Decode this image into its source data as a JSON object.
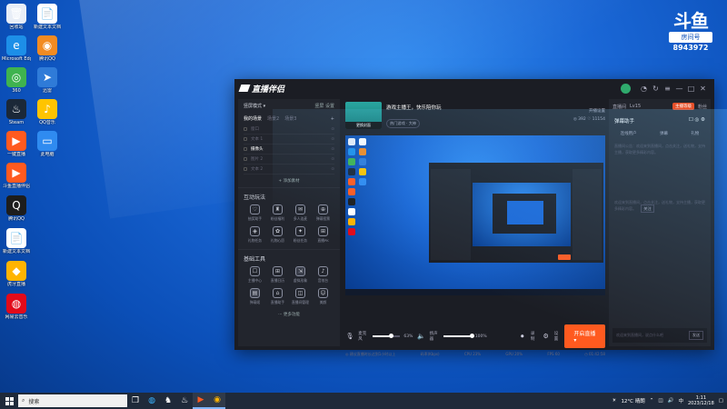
{
  "desktop": {
    "icons": [
      {
        "label": "回收站",
        "color": "#e8eef7",
        "glyph": "🗑"
      },
      {
        "label": "新建文本文档",
        "color": "#ffffff",
        "glyph": "📄"
      },
      {
        "label": "Microsoft Edge",
        "color": "#1d8fe8",
        "glyph": "e"
      },
      {
        "label": "腾讯QQ",
        "color": "#f28b22",
        "glyph": "◉"
      },
      {
        "label": "360",
        "color": "#3fb34f",
        "glyph": "◎"
      },
      {
        "label": "迅雷",
        "color": "#2f7bd8",
        "glyph": "➤"
      },
      {
        "label": "Steam",
        "color": "#1b2838",
        "glyph": "♨"
      },
      {
        "label": "QQ音乐",
        "color": "#ffc400",
        "glyph": "♪"
      },
      {
        "label": "一键直播",
        "color": "#ff5a1f",
        "glyph": "▶"
      },
      {
        "label": "此电脑",
        "color": "#2f8bf0",
        "glyph": "▭"
      },
      {
        "label": "斗鱼直播伴侣",
        "color": "#ff5a1f",
        "glyph": "▶"
      },
      {
        "label": "",
        "color": "",
        "glyph": ""
      },
      {
        "label": "腾讯QQ",
        "color": "#1d1d1d",
        "glyph": "Q"
      },
      {
        "label": "",
        "color": "",
        "glyph": ""
      },
      {
        "label": "新建文本文档",
        "color": "#ffffff",
        "glyph": "📄"
      },
      {
        "label": "",
        "color": "",
        "glyph": ""
      },
      {
        "label": "虎牙直播",
        "color": "#ffb400",
        "glyph": "◆"
      },
      {
        "label": "",
        "color": "",
        "glyph": ""
      },
      {
        "label": "网易云音乐",
        "color": "#e20a1a",
        "glyph": "◍"
      }
    ],
    "watermark": {
      "logo": "斗鱼",
      "sub": "房间号",
      "number": "8943972"
    }
  },
  "app": {
    "title": "直播伴侣",
    "left": {
      "mode": "竖屏模式 ▾",
      "switch_link": "竖屏",
      "settings_link": "设置",
      "tabs": [
        "我的场景",
        "场景2",
        "场景3"
      ],
      "scenes": [
        {
          "name": "窗口",
          "selected": false
        },
        {
          "name": "文本 1",
          "selected": false
        },
        {
          "name": "摄像头",
          "selected": true
        },
        {
          "name": "图片 2",
          "selected": false
        },
        {
          "name": "文本 2",
          "selected": false
        }
      ],
      "add_source": "+ 添加素材",
      "interact_title": "互动玩法",
      "interact_tools": [
        {
          "label": "抽奖助手",
          "glyph": "♡"
        },
        {
          "label": "粉丝福利",
          "glyph": "♜"
        },
        {
          "label": "多人连麦",
          "glyph": "✉"
        },
        {
          "label": "弹幕投票",
          "glyph": "⊕"
        },
        {
          "label": "礼物任务",
          "glyph": "◈"
        },
        {
          "label": "礼物心愿",
          "glyph": "✿"
        },
        {
          "label": "粉丝任务",
          "glyph": "✦"
        },
        {
          "label": "直播PK",
          "glyph": "⊞"
        }
      ],
      "tools_title": "基础工具",
      "basic_tools": [
        {
          "label": "主播中心",
          "glyph": "☐",
          "hl": false
        },
        {
          "label": "直播日历",
          "glyph": "⊞",
          "hl": false
        },
        {
          "label": "虚拟形象",
          "glyph": "⇲",
          "hl": true
        },
        {
          "label": "音效台",
          "glyph": "♪",
          "hl": false
        },
        {
          "label": "弹幕姬",
          "glyph": "▤",
          "hl": true
        },
        {
          "label": "直播助手",
          "glyph": "⌂",
          "hl": false
        },
        {
          "label": "直播间管理",
          "glyph": "◫",
          "hl": false
        },
        {
          "label": "美颜",
          "glyph": "☺",
          "hl": false
        }
      ],
      "more": "··· 更多功能"
    },
    "center": {
      "cover_label": "更换封面",
      "stream_title": "游戏主播王，快乐陪你玩",
      "category": "热门游戏 · 大神",
      "meta_top": "开播设置",
      "viewers": "◎ 392",
      "likes": "♡ 11154",
      "controls": {
        "mic_label": "麦克风",
        "mic_value": "63%",
        "speaker_label": "扬声器",
        "speaker_value": "100%",
        "record_label": "录制",
        "settings_label": "设置",
        "go_live": "开启直播 ▾"
      },
      "status": {
        "left": "◎ 建议直播时长达到1小时以上",
        "bitrate": "码率(Kbps)",
        "cpu": "CPU 23%",
        "gpu": "GPU 20%",
        "fps": "FPS 60",
        "duration": "◷ 01:42:58"
      }
    },
    "right": {
      "room_label": "直播间",
      "level": "Lv15",
      "badge": "主播等级",
      "extra": "粉丝",
      "title": "弹幕助手",
      "tabs": [
        "连线用户",
        "弹幕",
        "礼物"
      ],
      "note1": "直播间公告：欢迎来到直播间，点击关注，送礼物，支持主播，获取更多精彩内容。",
      "note2": "欢迎来到直播间，点击关注，送礼物，支持主播，获取更多精彩内容。",
      "note_btn": "关注",
      "input_placeholder": "欢迎来到直播间，说点什么吧",
      "send": "发送"
    }
  },
  "taskbar": {
    "search_placeholder": "搜索",
    "weather": "12°C 晴朗",
    "time": "1:11",
    "date": "2023/12/18"
  }
}
